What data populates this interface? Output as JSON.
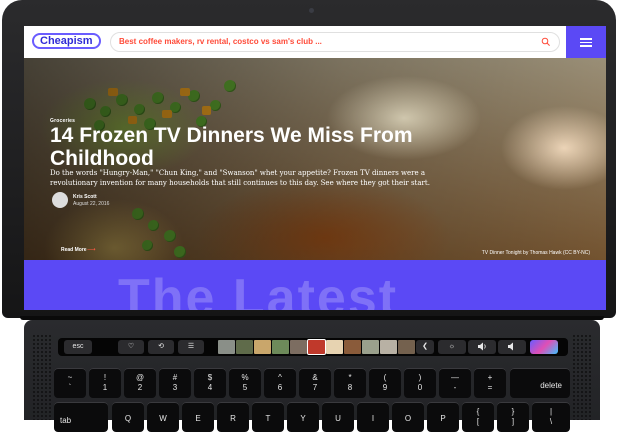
{
  "site": {
    "logo": "Cheapism",
    "search_placeholder": "Best coffee makers, rv rental, costco vs sam's club ...",
    "menu_icon": "hamburger-icon"
  },
  "hero": {
    "category": "Groceries",
    "title": "14 Frozen TV Dinners We Miss From Childhood",
    "description": "Do the words \"Hungry-Man,\" \"Chun King,\" and \"Swanson\" whet your appetite? Frozen TV dinners were a revolutionary invention for many households that still continues to this day. See where they got their start.",
    "author": "Kris Scott",
    "date": "August 22, 2016",
    "read_more": "Read More",
    "photo_caption": "TV Dinner Tonight by Thomas Hawk (CC BY-NC)"
  },
  "section": {
    "heading": "The Latest"
  },
  "touchbar": {
    "esc": "esc",
    "icons": [
      "heart-icon",
      "loop-icon",
      "sliders-icon",
      "chevron-left-icon",
      "brightness-icon",
      "volume-icon",
      "mute-icon",
      "siri-icon"
    ],
    "chevron": "❮",
    "brightness": "☼",
    "thumbnail_colors": [
      "#8a8f88",
      "#5f6b4a",
      "#c9a66b",
      "#6d8a5a",
      "#7c6d61",
      "#c0392b",
      "#e7d3b1",
      "#8a5b3a",
      "#9aa08c",
      "#b8b1a4",
      "#74614e"
    ]
  },
  "keyboard": {
    "row1": [
      {
        "top": "~",
        "bot": "`"
      },
      {
        "top": "!",
        "bot": "1"
      },
      {
        "top": "@",
        "bot": "2"
      },
      {
        "top": "#",
        "bot": "3"
      },
      {
        "top": "$",
        "bot": "4"
      },
      {
        "top": "%",
        "bot": "5"
      },
      {
        "top": "^",
        "bot": "6"
      },
      {
        "top": "&",
        "bot": "7"
      },
      {
        "top": "*",
        "bot": "8"
      },
      {
        "top": "(",
        "bot": "9"
      },
      {
        "top": ")",
        "bot": "0"
      },
      {
        "top": "—",
        "bot": "-"
      },
      {
        "top": "+",
        "bot": "="
      }
    ],
    "delete": "delete",
    "tab": "tab",
    "row2": [
      "Q",
      "W",
      "E",
      "R",
      "T",
      "Y",
      "U",
      "I",
      "O",
      "P"
    ],
    "row2_partial": [
      {
        "top": "{",
        "bot": "["
      },
      {
        "top": "}",
        "bot": "]"
      },
      {
        "top": "|",
        "bot": "\\"
      }
    ]
  }
}
